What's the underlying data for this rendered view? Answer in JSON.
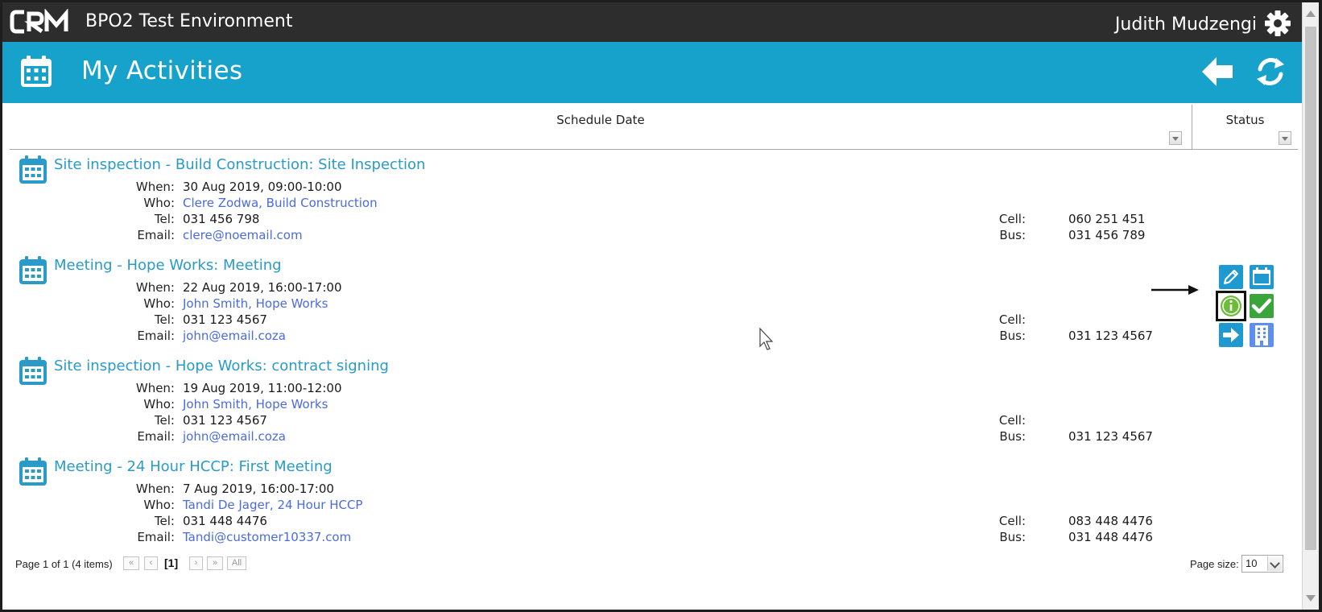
{
  "app": {
    "logo_text": "CRM",
    "environment": "BPO2 Test Environment",
    "user_name": "Judith Mudzengi"
  },
  "header": {
    "title": "My Activities"
  },
  "columns": {
    "schedule_date": "Schedule Date",
    "status": "Status"
  },
  "labels": {
    "when": "When:",
    "who": "Who:",
    "tel": "Tel:",
    "email": "Email:",
    "cell": "Cell:",
    "bus": "Bus:"
  },
  "activities": [
    {
      "title": "Site inspection - Build Construction: Site Inspection",
      "when": "30 Aug 2019, 09:00-10:00",
      "who": "Clere Zodwa, Build Construction",
      "tel": "031 456 798",
      "email": "clere@noemail.com",
      "cell": "060 251 451",
      "bus": "031 456 789"
    },
    {
      "title": "Meeting - Hope Works: Meeting",
      "when": "22 Aug 2019, 16:00-17:00",
      "who": "John Smith, Hope Works",
      "tel": "031 123 4567",
      "email": "john@email.coza",
      "cell": "",
      "bus": "031 123 4567"
    },
    {
      "title": "Site inspection - Hope Works: contract signing",
      "when": "19 Aug 2019, 11:00-12:00",
      "who": "John Smith, Hope Works",
      "tel": "031 123 4567",
      "email": "john@email.coza",
      "cell": "",
      "bus": "031 123 4567"
    },
    {
      "title": "Meeting - 24 Hour HCCP: First Meeting",
      "when": "7 Aug 2019, 16:00-17:00",
      "who": "Tandi De Jager, 24 Hour HCCP",
      "tel": "031 448 4476",
      "email": "Tandi@customer10337.com",
      "cell": "083 448 4476",
      "bus": "031 448 4476"
    }
  ],
  "row_tools": {
    "icons": [
      "pencil-icon",
      "calendar-icon",
      "info-icon",
      "check-icon",
      "arrow-right-icon",
      "building-icon"
    ],
    "highlighted": "info-icon"
  },
  "pager": {
    "info": "Page 1 of 1 (4 items)",
    "first": "«",
    "prev": "‹",
    "current": "[1]",
    "next": "›",
    "last": "»",
    "all": "All"
  },
  "page_size": {
    "label": "Page size:",
    "value": "10"
  },
  "colors": {
    "topbar": "#2d2d2d",
    "accent": "#17a2cc",
    "title_link": "#2a9bc8",
    "contact_link": "#4a6be0",
    "check_green": "#3aa53a",
    "info_green": "#6dbb3a"
  }
}
